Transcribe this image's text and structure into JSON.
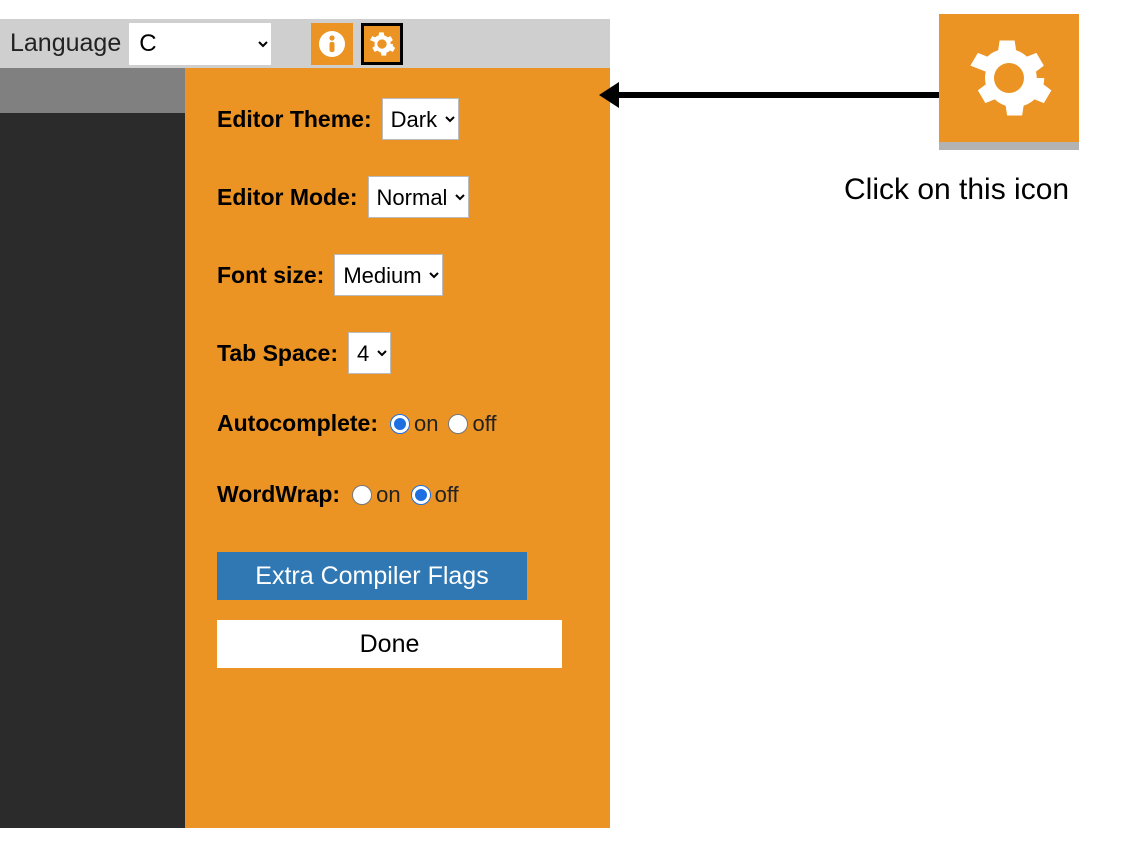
{
  "toolbar": {
    "language_label": "Language",
    "language_value": "C"
  },
  "settings": {
    "editor_theme_label": "Editor Theme:",
    "editor_theme_value": "Dark",
    "editor_mode_label": "Editor Mode:",
    "editor_mode_value": "Normal",
    "font_size_label": "Font size:",
    "font_size_value": "Medium",
    "tab_space_label": "Tab Space:",
    "tab_space_value": "4",
    "autocomplete_label": "Autocomplete:",
    "autocomplete_on": "on",
    "autocomplete_off": "off",
    "autocomplete_selected": "on",
    "wordwrap_label": "WordWrap:",
    "wordwrap_on": "on",
    "wordwrap_off": "off",
    "wordwrap_selected": "off",
    "flags_button": "Extra Compiler Flags",
    "done_button": "Done"
  },
  "callout": {
    "text": "Click on this icon"
  }
}
